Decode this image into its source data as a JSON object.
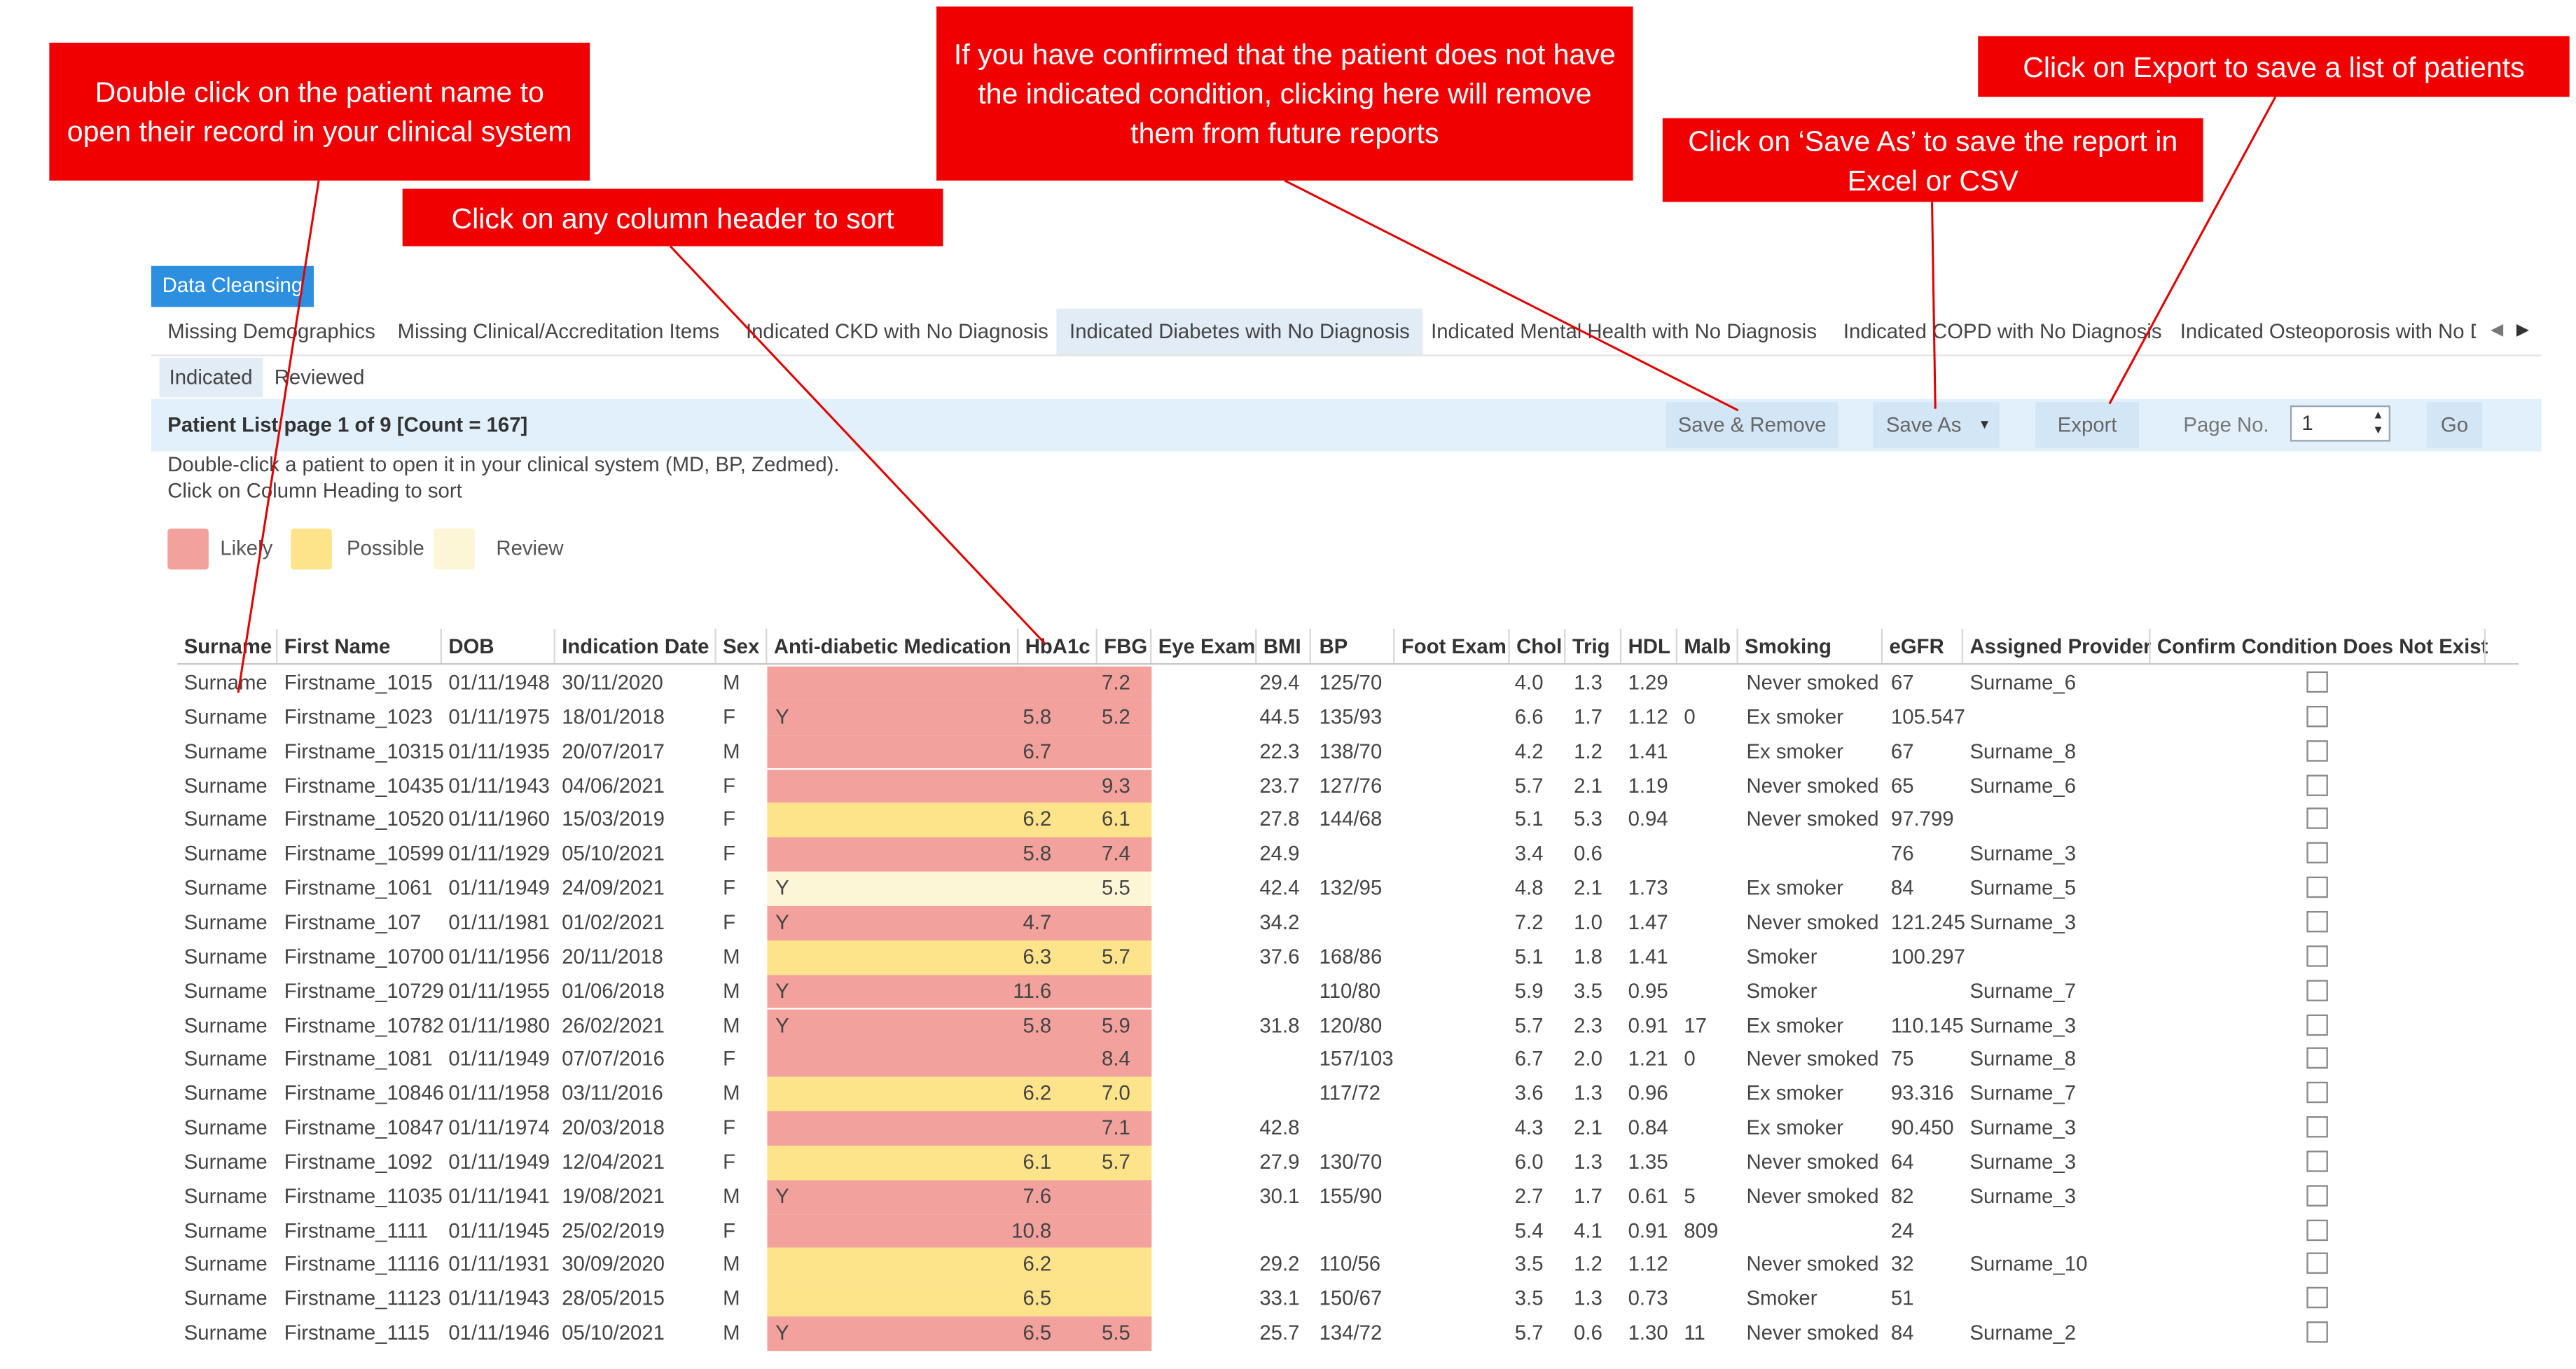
{
  "callouts": {
    "double_click": "Double click on the patient name to open their record in your clinical system",
    "sort": "Click on any column header to sort",
    "remove": "If you have confirmed that the patient does not have the indicated condition, clicking here will remove them from future reports",
    "save_as": "Click on ‘Save As’ to save the report in Excel or  CSV",
    "export": "Click on Export to save a list of patients"
  },
  "group_tab": "Data Cleansing",
  "tabs": [
    "Missing Demographics",
    "Missing Clinical/Accreditation Items",
    "Indicated CKD with No Diagnosis",
    "Indicated Diabetes with No Diagnosis",
    "Indicated Mental Health with No Diagnosis",
    "Indicated COPD with No Diagnosis",
    "Indicated Osteoporosis with No D"
  ],
  "subtabs": [
    "Indicated",
    "Reviewed"
  ],
  "toolbar": {
    "title": "Patient List page 1 of 9 [Count = 167]",
    "save_remove": "Save & Remove",
    "save_as": "Save As",
    "export": "Export",
    "page_label": "Page No.",
    "page_value": "1",
    "go": "Go"
  },
  "instructions": [
    "Double-click a patient to open it in your clinical system (MD, BP, Zedmed).",
    "Click on Column Heading to sort"
  ],
  "legend": [
    {
      "label": "Likely",
      "color": "#f2a19c"
    },
    {
      "label": "Possible",
      "color": "#fde38a"
    },
    {
      "label": "Review",
      "color": "#fdf6d6"
    }
  ],
  "colors": {
    "likely": "#f2a19c",
    "possible": "#fde38a",
    "review": "#fdf6d6",
    "accent": "#2d8fe0",
    "callout": "#f00000"
  },
  "columns": [
    "Surname",
    "First Name",
    "DOB",
    "Indication Date",
    "Sex",
    "Anti-diabetic Medication",
    "HbA1c",
    "FBG",
    "Eye Exam",
    "BMI",
    "BP",
    "Foot Exam",
    "Chol",
    "Trig",
    "HDL",
    "Malb",
    "Smoking",
    "eGFR",
    "Assigned Provider",
    "Confirm Condition Does Not Exist"
  ],
  "rows": [
    {
      "surname": "Surname",
      "first": "Firstname_1015",
      "dob": "01/11/1948",
      "ind": "30/11/2020",
      "sex": "M",
      "med": "",
      "hba1c": "",
      "fbg": "7.2",
      "eye": "",
      "bmi": "29.4",
      "bp": "125/70",
      "foot": "",
      "chol": "4.0",
      "trig": "1.3",
      "hdl": "1.29",
      "malb": "",
      "smoking": "Never smoked",
      "egfr": "67",
      "provider": "Surname_6",
      "level": "likely"
    },
    {
      "surname": "Surname",
      "first": "Firstname_1023",
      "dob": "01/11/1975",
      "ind": "18/01/2018",
      "sex": "F",
      "med": "Y",
      "hba1c": "5.8",
      "fbg": "5.2",
      "eye": "",
      "bmi": "44.5",
      "bp": "135/93",
      "foot": "",
      "chol": "6.6",
      "trig": "1.7",
      "hdl": "1.12",
      "malb": "0",
      "smoking": "Ex smoker",
      "egfr": "105.547",
      "provider": "",
      "level": "likely"
    },
    {
      "surname": "Surname",
      "first": "Firstname_10315",
      "dob": "01/11/1935",
      "ind": "20/07/2017",
      "sex": "M",
      "med": "",
      "hba1c": "6.7",
      "fbg": "",
      "eye": "",
      "bmi": "22.3",
      "bp": "138/70",
      "foot": "",
      "chol": "4.2",
      "trig": "1.2",
      "hdl": "1.41",
      "malb": "",
      "smoking": "Ex smoker",
      "egfr": "67",
      "provider": "Surname_8",
      "level": "likely"
    },
    {
      "surname": "Surname",
      "first": "Firstname_10435",
      "dob": "01/11/1943",
      "ind": "04/06/2021",
      "sex": "F",
      "med": "",
      "hba1c": "",
      "fbg": "9.3",
      "eye": "",
      "bmi": "23.7",
      "bp": "127/76",
      "foot": "",
      "chol": "5.7",
      "trig": "2.1",
      "hdl": "1.19",
      "malb": "",
      "smoking": "Never smoked",
      "egfr": "65",
      "provider": "Surname_6",
      "level": "likely"
    },
    {
      "surname": "Surname",
      "first": "Firstname_10520",
      "dob": "01/11/1960",
      "ind": "15/03/2019",
      "sex": "F",
      "med": "",
      "hba1c": "6.2",
      "fbg": "6.1",
      "eye": "",
      "bmi": "27.8",
      "bp": "144/68",
      "foot": "",
      "chol": "5.1",
      "trig": "5.3",
      "hdl": "0.94",
      "malb": "",
      "smoking": "Never smoked",
      "egfr": "97.799",
      "provider": "",
      "level": "possible"
    },
    {
      "surname": "Surname",
      "first": "Firstname_10599",
      "dob": "01/11/1929",
      "ind": "05/10/2021",
      "sex": "F",
      "med": "",
      "hba1c": "5.8",
      "fbg": "7.4",
      "eye": "",
      "bmi": "24.9",
      "bp": "",
      "foot": "",
      "chol": "3.4",
      "trig": "0.6",
      "hdl": "",
      "malb": "",
      "smoking": "",
      "egfr": "76",
      "provider": "Surname_3",
      "level": "likely"
    },
    {
      "surname": "Surname",
      "first": "Firstname_1061",
      "dob": "01/11/1949",
      "ind": "24/09/2021",
      "sex": "F",
      "med": "Y",
      "hba1c": "",
      "fbg": "5.5",
      "eye": "",
      "bmi": "42.4",
      "bp": "132/95",
      "foot": "",
      "chol": "4.8",
      "trig": "2.1",
      "hdl": "1.73",
      "malb": "",
      "smoking": "Ex smoker",
      "egfr": "84",
      "provider": "Surname_5",
      "level": "review"
    },
    {
      "surname": "Surname",
      "first": "Firstname_107",
      "dob": "01/11/1981",
      "ind": "01/02/2021",
      "sex": "F",
      "med": "Y",
      "hba1c": "4.7",
      "fbg": "",
      "eye": "",
      "bmi": "34.2",
      "bp": "",
      "foot": "",
      "chol": "7.2",
      "trig": "1.0",
      "hdl": "1.47",
      "malb": "",
      "smoking": "Never smoked",
      "egfr": "121.245",
      "provider": "Surname_3",
      "level": "likely"
    },
    {
      "surname": "Surname",
      "first": "Firstname_10700",
      "dob": "01/11/1956",
      "ind": "20/11/2018",
      "sex": "M",
      "med": "",
      "hba1c": "6.3",
      "fbg": "5.7",
      "eye": "",
      "bmi": "37.6",
      "bp": "168/86",
      "foot": "",
      "chol": "5.1",
      "trig": "1.8",
      "hdl": "1.41",
      "malb": "",
      "smoking": "Smoker",
      "egfr": "100.297",
      "provider": "",
      "level": "possible"
    },
    {
      "surname": "Surname",
      "first": "Firstname_10729",
      "dob": "01/11/1955",
      "ind": "01/06/2018",
      "sex": "M",
      "med": "Y",
      "hba1c": "11.6",
      "fbg": "",
      "eye": "",
      "bmi": "",
      "bp": "110/80",
      "foot": "",
      "chol": "5.9",
      "trig": "3.5",
      "hdl": "0.95",
      "malb": "",
      "smoking": "Smoker",
      "egfr": "",
      "provider": "Surname_7",
      "level": "likely"
    },
    {
      "surname": "Surname",
      "first": "Firstname_10782",
      "dob": "01/11/1980",
      "ind": "26/02/2021",
      "sex": "M",
      "med": "Y",
      "hba1c": "5.8",
      "fbg": "5.9",
      "eye": "",
      "bmi": "31.8",
      "bp": "120/80",
      "foot": "",
      "chol": "5.7",
      "trig": "2.3",
      "hdl": "0.91",
      "malb": "17",
      "smoking": "Ex smoker",
      "egfr": "110.145",
      "provider": "Surname_3",
      "level": "likely"
    },
    {
      "surname": "Surname",
      "first": "Firstname_1081",
      "dob": "01/11/1949",
      "ind": "07/07/2016",
      "sex": "F",
      "med": "",
      "hba1c": "",
      "fbg": "8.4",
      "eye": "",
      "bmi": "",
      "bp": "157/103",
      "foot": "",
      "chol": "6.7",
      "trig": "2.0",
      "hdl": "1.21",
      "malb": "0",
      "smoking": "Never smoked",
      "egfr": "75",
      "provider": "Surname_8",
      "level": "likely"
    },
    {
      "surname": "Surname",
      "first": "Firstname_10846",
      "dob": "01/11/1958",
      "ind": "03/11/2016",
      "sex": "M",
      "med": "",
      "hba1c": "6.2",
      "fbg": "7.0",
      "eye": "",
      "bmi": "",
      "bp": "117/72",
      "foot": "",
      "chol": "3.6",
      "trig": "1.3",
      "hdl": "0.96",
      "malb": "",
      "smoking": "Ex smoker",
      "egfr": "93.316",
      "provider": "Surname_7",
      "level": "possible"
    },
    {
      "surname": "Surname",
      "first": "Firstname_10847",
      "dob": "01/11/1974",
      "ind": "20/03/2018",
      "sex": "F",
      "med": "",
      "hba1c": "",
      "fbg": "7.1",
      "eye": "",
      "bmi": "42.8",
      "bp": "",
      "foot": "",
      "chol": "4.3",
      "trig": "2.1",
      "hdl": "0.84",
      "malb": "",
      "smoking": "Ex smoker",
      "egfr": "90.450",
      "provider": "Surname_3",
      "level": "likely"
    },
    {
      "surname": "Surname",
      "first": "Firstname_1092",
      "dob": "01/11/1949",
      "ind": "12/04/2021",
      "sex": "F",
      "med": "",
      "hba1c": "6.1",
      "fbg": "5.7",
      "eye": "",
      "bmi": "27.9",
      "bp": "130/70",
      "foot": "",
      "chol": "6.0",
      "trig": "1.3",
      "hdl": "1.35",
      "malb": "",
      "smoking": "Never smoked",
      "egfr": "64",
      "provider": "Surname_3",
      "level": "possible"
    },
    {
      "surname": "Surname",
      "first": "Firstname_11035",
      "dob": "01/11/1941",
      "ind": "19/08/2021",
      "sex": "M",
      "med": "Y",
      "hba1c": "7.6",
      "fbg": "",
      "eye": "",
      "bmi": "30.1",
      "bp": "155/90",
      "foot": "",
      "chol": "2.7",
      "trig": "1.7",
      "hdl": "0.61",
      "malb": "5",
      "smoking": "Never smoked",
      "egfr": "82",
      "provider": "Surname_3",
      "level": "likely"
    },
    {
      "surname": "Surname",
      "first": "Firstname_1111",
      "dob": "01/11/1945",
      "ind": "25/02/2019",
      "sex": "F",
      "med": "",
      "hba1c": "10.8",
      "fbg": "",
      "eye": "",
      "bmi": "",
      "bp": "",
      "foot": "",
      "chol": "5.4",
      "trig": "4.1",
      "hdl": "0.91",
      "malb": "809",
      "smoking": "",
      "egfr": "24",
      "provider": "",
      "level": "likely"
    },
    {
      "surname": "Surname",
      "first": "Firstname_11116",
      "dob": "01/11/1931",
      "ind": "30/09/2020",
      "sex": "M",
      "med": "",
      "hba1c": "6.2",
      "fbg": "",
      "eye": "",
      "bmi": "29.2",
      "bp": "110/56",
      "foot": "",
      "chol": "3.5",
      "trig": "1.2",
      "hdl": "1.12",
      "malb": "",
      "smoking": "Never smoked",
      "egfr": "32",
      "provider": "Surname_10",
      "level": "possible"
    },
    {
      "surname": "Surname",
      "first": "Firstname_11123",
      "dob": "01/11/1943",
      "ind": "28/05/2015",
      "sex": "M",
      "med": "",
      "hba1c": "6.5",
      "fbg": "",
      "eye": "",
      "bmi": "33.1",
      "bp": "150/67",
      "foot": "",
      "chol": "3.5",
      "trig": "1.3",
      "hdl": "0.73",
      "malb": "",
      "smoking": "Smoker",
      "egfr": "51",
      "provider": "",
      "level": "possible"
    },
    {
      "surname": "Surname",
      "first": "Firstname_1115",
      "dob": "01/11/1946",
      "ind": "05/10/2021",
      "sex": "M",
      "med": "Y",
      "hba1c": "6.5",
      "fbg": "5.5",
      "eye": "",
      "bmi": "25.7",
      "bp": "134/72",
      "foot": "",
      "chol": "5.7",
      "trig": "0.6",
      "hdl": "1.30",
      "malb": "11",
      "smoking": "Never smoked",
      "egfr": "84",
      "provider": "Surname_2",
      "level": "likely"
    }
  ]
}
